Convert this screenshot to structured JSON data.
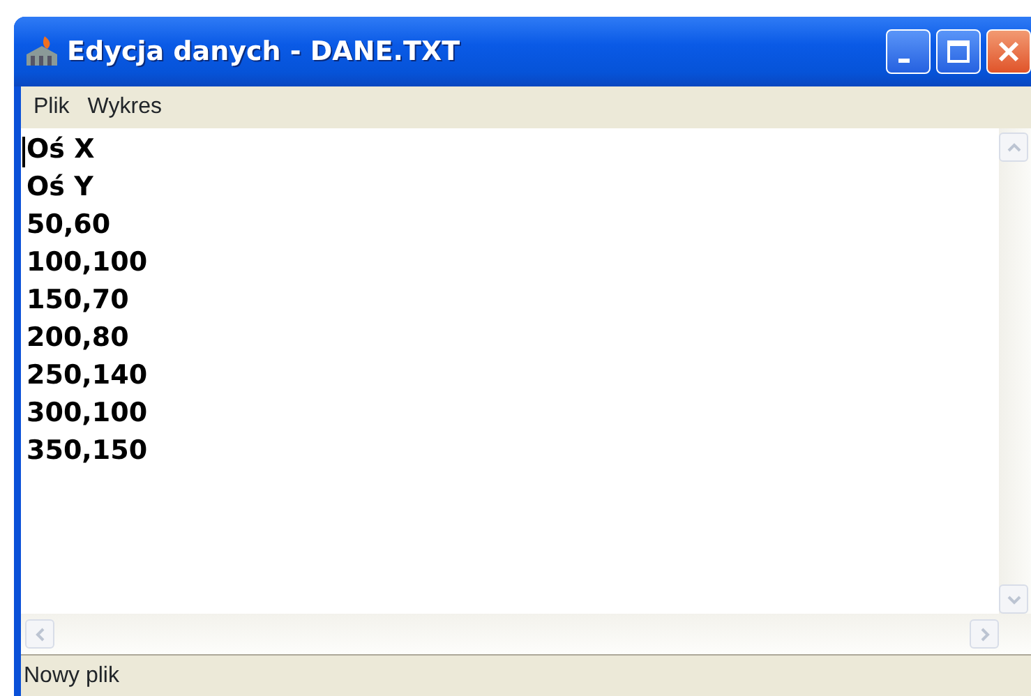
{
  "window": {
    "title": "Edycja danych - DANE.TXT"
  },
  "menu": [
    "Plik",
    "Wykres"
  ],
  "editor": {
    "lines": [
      "Oś X",
      "Oś Y",
      "50,60",
      "100,100",
      "150,70",
      "200,80",
      "250,140",
      "300,100",
      "350,150"
    ]
  },
  "status_bar": "Nowy plik"
}
